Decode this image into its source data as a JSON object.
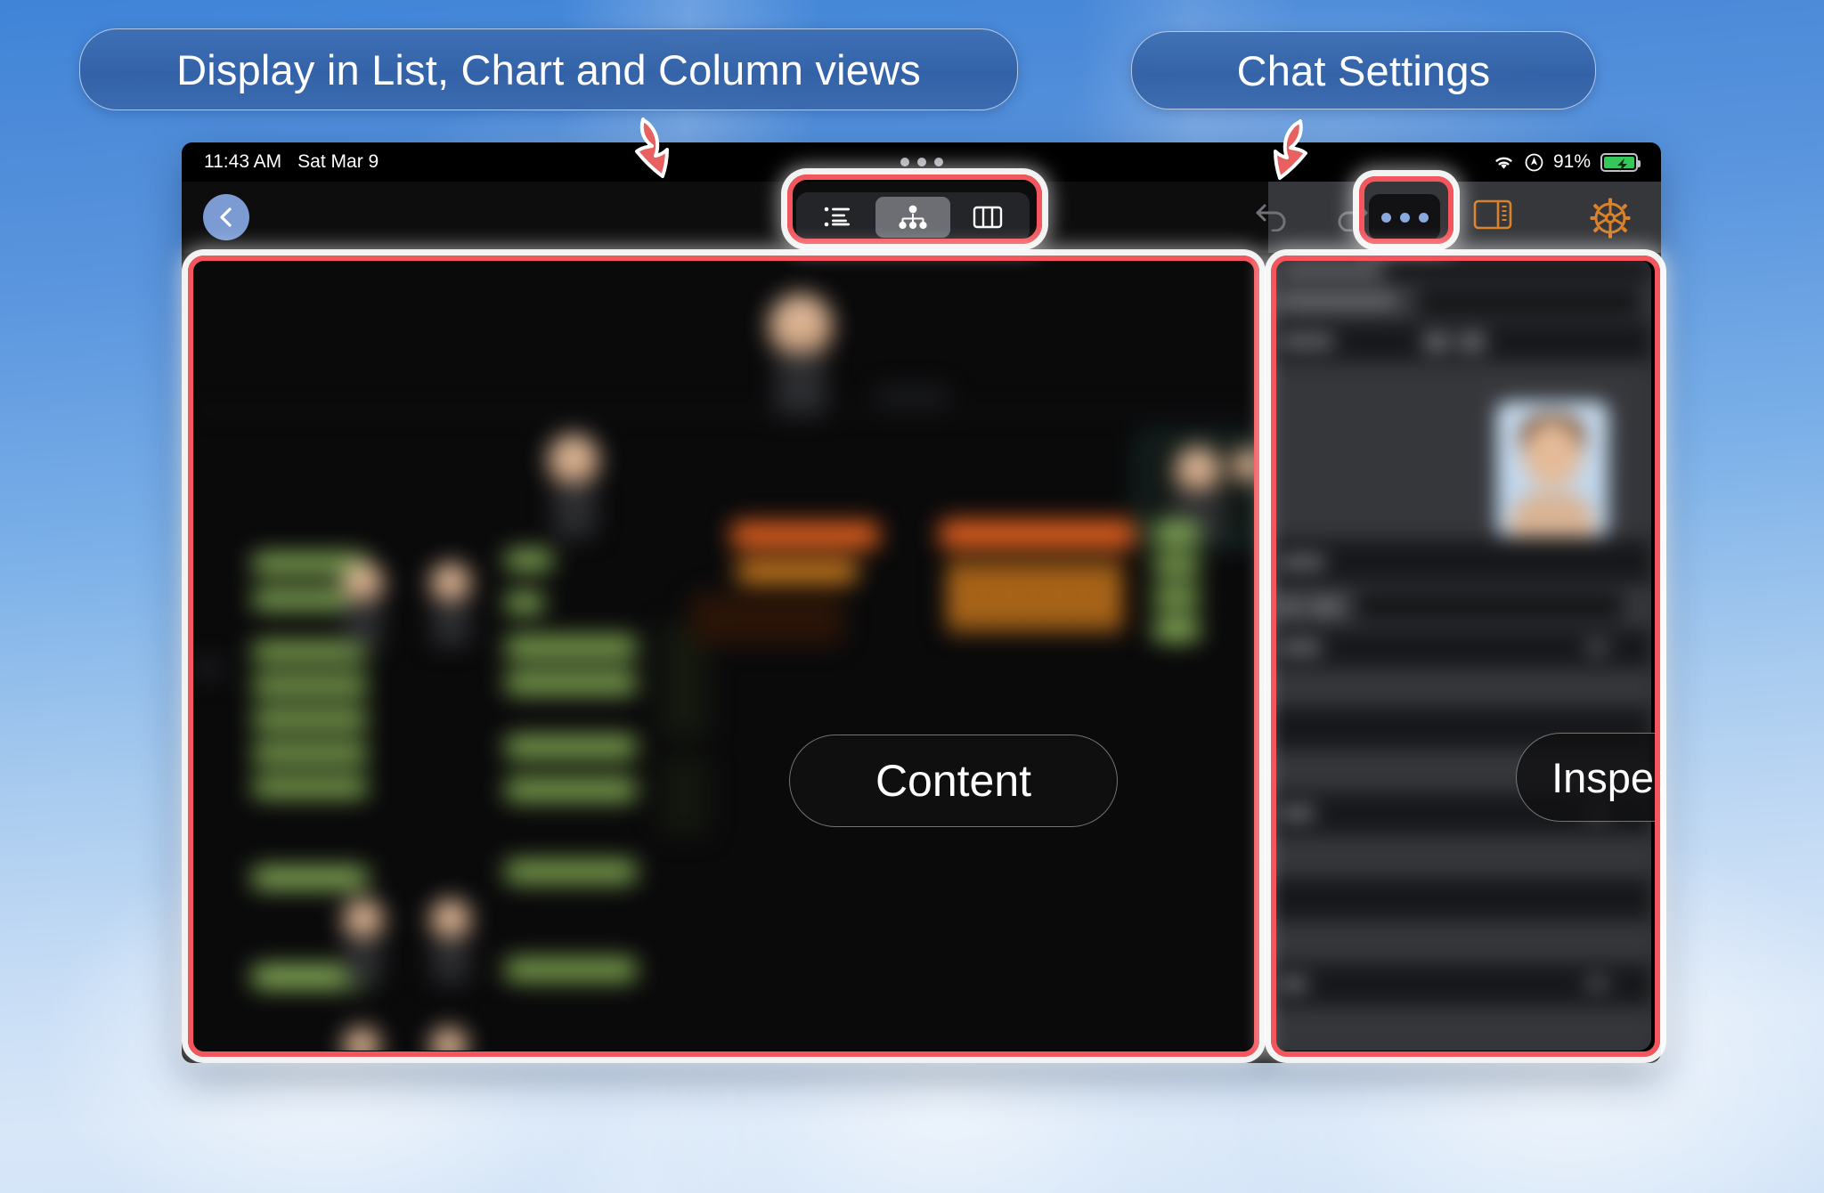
{
  "annotations": {
    "views_callout": "Display in List, Chart and Column views",
    "chat_callout": "Chat Settings",
    "content_pill": "Content",
    "inspector_pill": "Inspectors"
  },
  "status_bar": {
    "time": "11:43 AM",
    "date": "Sat Mar 9",
    "battery_percent": "91%",
    "wifi_icon": "wifi-icon",
    "location_icon": "location-icon",
    "battery_icon": "battery-charging-icon",
    "multitask_handle": "multitasking-handle"
  },
  "toolbar": {
    "back_icon": "chevron-left-icon",
    "segments": [
      {
        "name": "list-view",
        "icon": "list-bullet-icon",
        "selected": false
      },
      {
        "name": "chart-view",
        "icon": "org-chart-icon",
        "selected": true
      },
      {
        "name": "column-view",
        "icon": "columns-icon",
        "selected": false
      }
    ],
    "undo_icon": "undo-arrow-icon",
    "redo_icon": "redo-arrow-icon",
    "more_label": "more-options",
    "sidebar_toggle_icon": "sidebar-right-icon",
    "settings_icon": "gear-icon"
  },
  "colors": {
    "accent_orange": "#d9822b",
    "highlight_red": "#f4565d",
    "selection_green": "#2e6a5e",
    "battery_green": "#34c759",
    "callout_blue": "#3e6eb2",
    "back_button_blue": "#7b9bd2"
  }
}
